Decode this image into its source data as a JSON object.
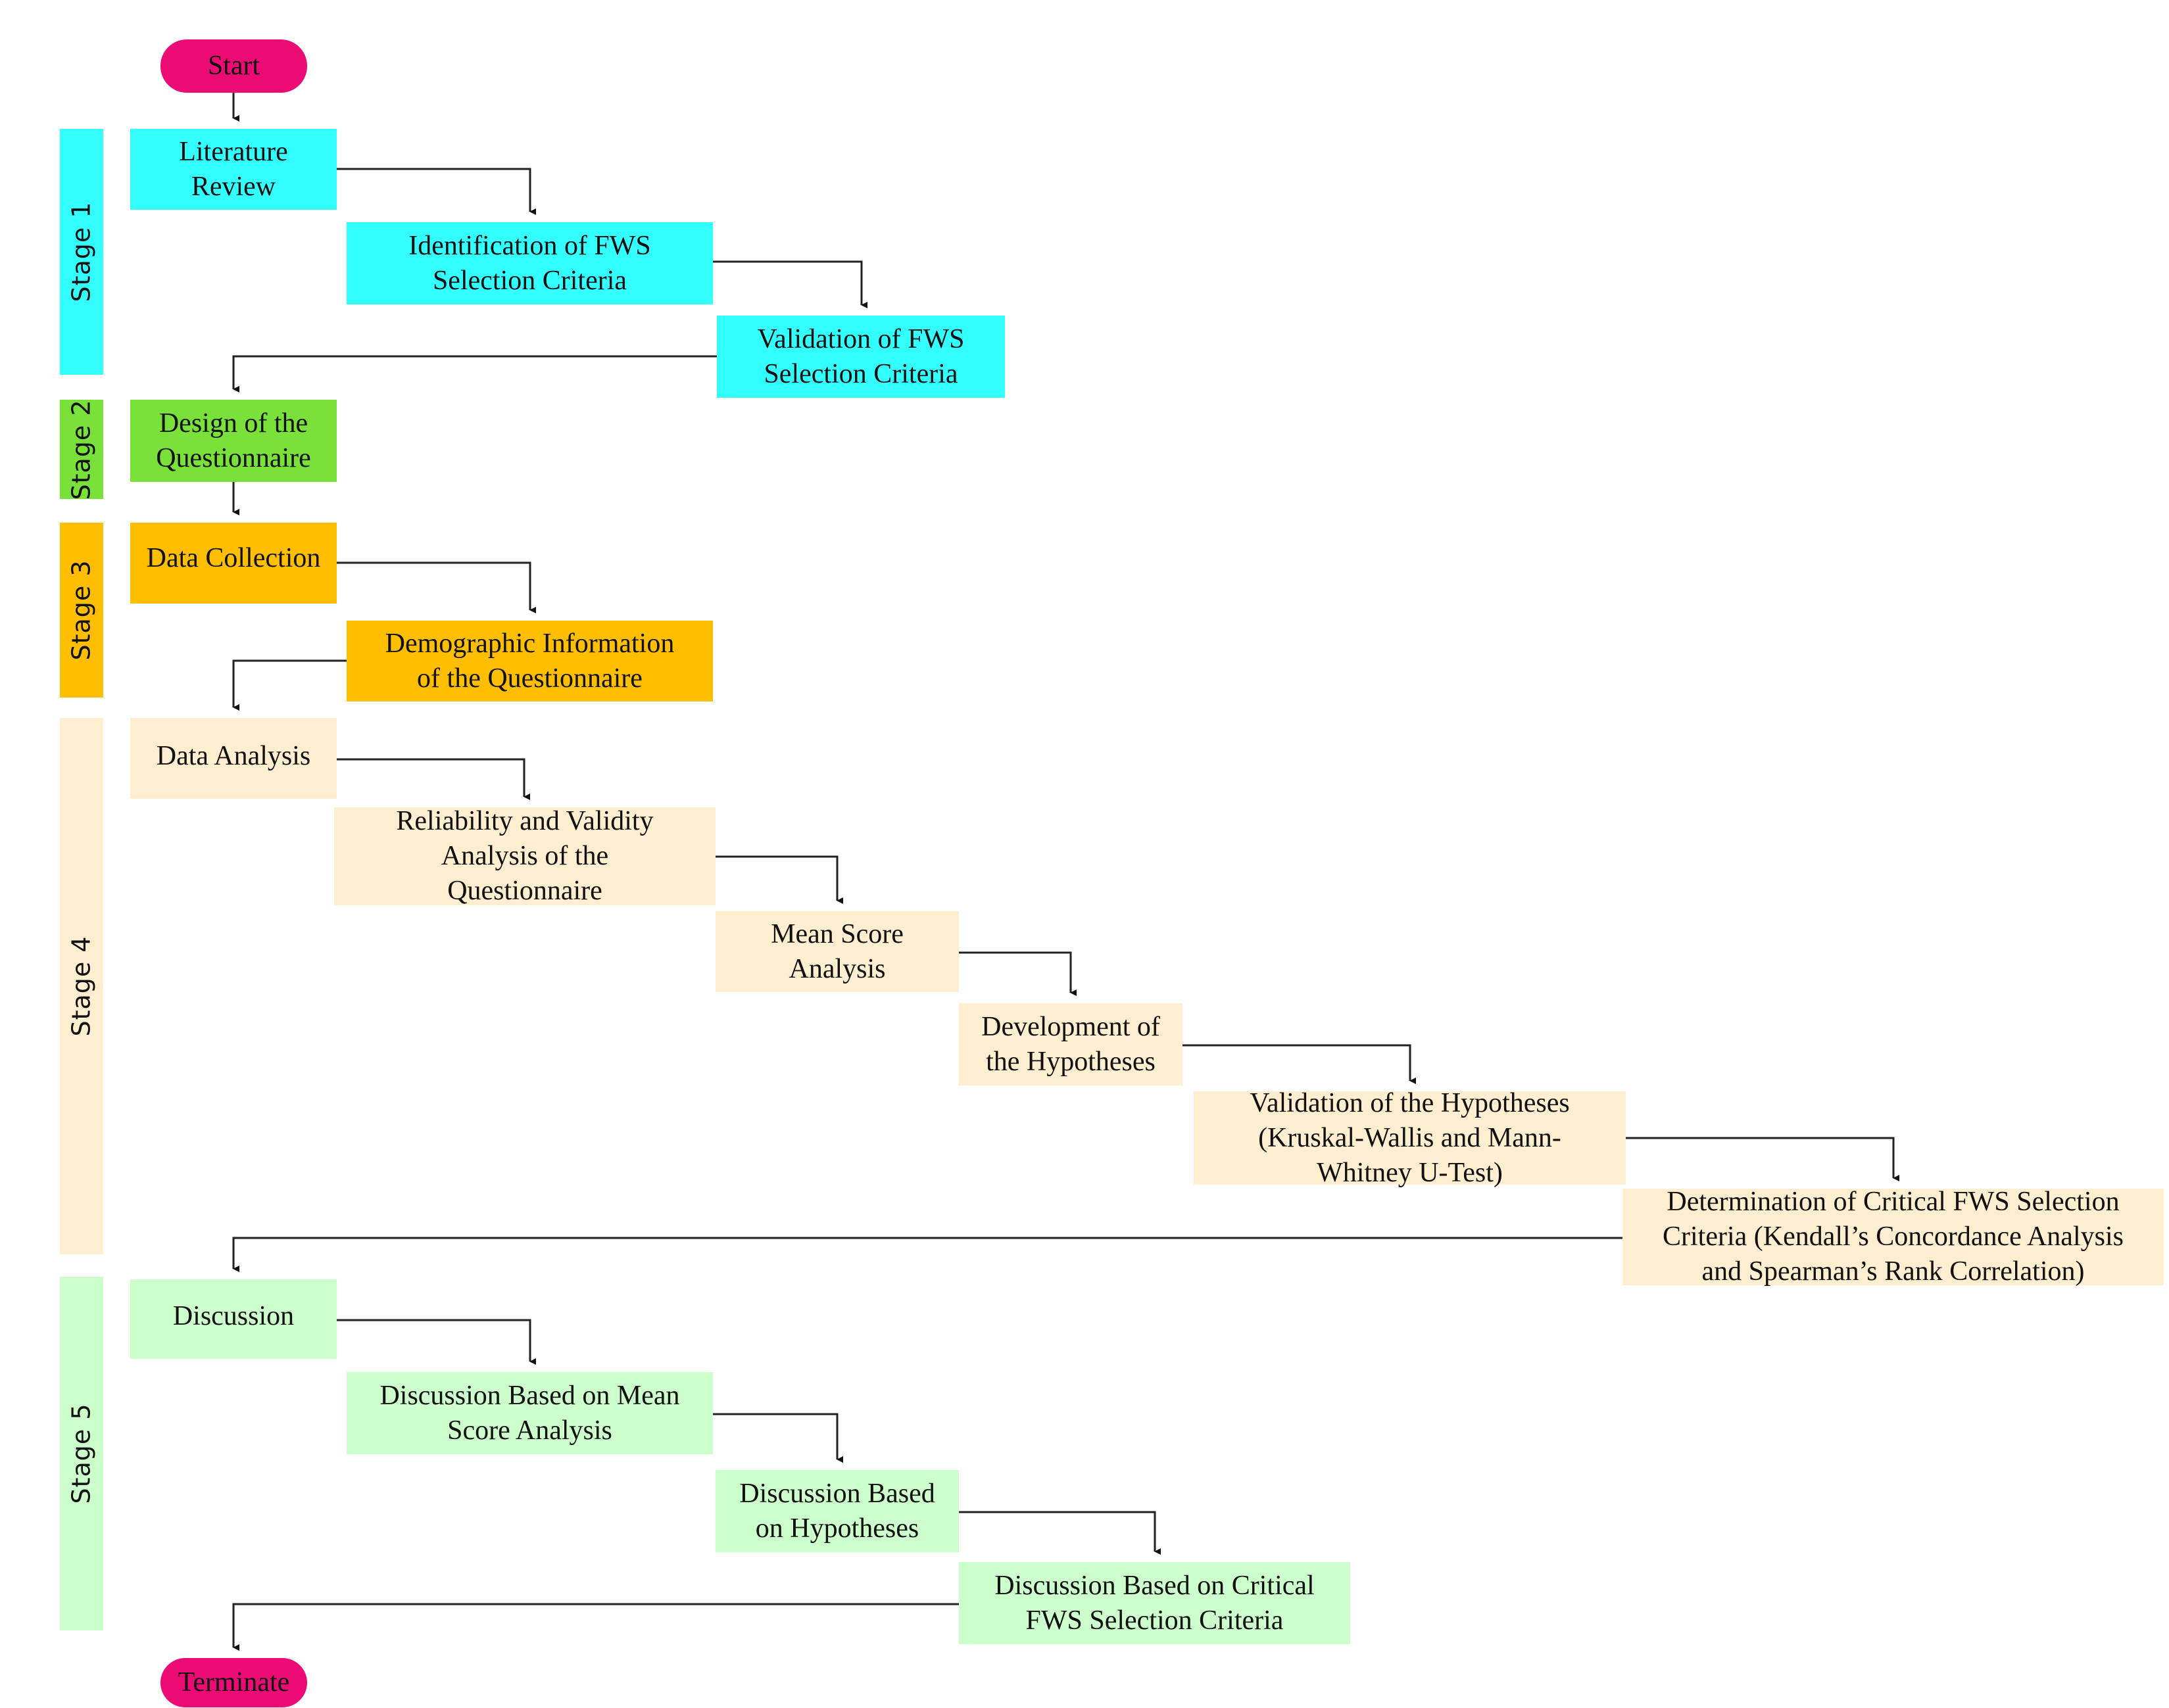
{
  "terminals": {
    "start": "Start",
    "end": "Terminate",
    "color": "#ec0a75"
  },
  "stages": [
    {
      "label": "Stage 1",
      "color": "#33ffff"
    },
    {
      "label": "Stage 2",
      "color": "#7ae03a"
    },
    {
      "label": "Stage 3",
      "color": "#ffbf00"
    },
    {
      "label": "Stage 4",
      "color": "#ffeecf"
    },
    {
      "label": "Stage 5",
      "color": "#ccffcc"
    }
  ],
  "steps": {
    "literature_review": "Literature\nReview",
    "identification": "Identification of FWS\nSelection Criteria",
    "validation_criteria": "Validation of FWS\nSelection Criteria",
    "design_questionnaire": "Design of the\nQuestionnaire",
    "data_collection": "Data Collection",
    "demographic": "Demographic Information\nof the Questionnaire",
    "data_analysis": "Data Analysis",
    "reliability": "Reliability and Validity\nAnalysis of the\nQuestionnaire",
    "mean_score": "Mean Score\nAnalysis",
    "development_hypotheses": "Development of\nthe Hypotheses",
    "validation_hypotheses": "Validation of the Hypotheses\n(Kruskal-Wallis and Mann-\nWhitney U-Test)",
    "determination": "Determination of Critical FWS Selection\nCriteria (Kendall’s Concordance Analysis\nand Spearman’s Rank Correlation)",
    "discussion": "Discussion",
    "discussion_mean": "Discussion Based on Mean\nScore Analysis",
    "discussion_hypotheses": "Discussion Based\non Hypotheses",
    "discussion_critical": "Discussion Based on Critical\nFWS Selection Criteria"
  }
}
